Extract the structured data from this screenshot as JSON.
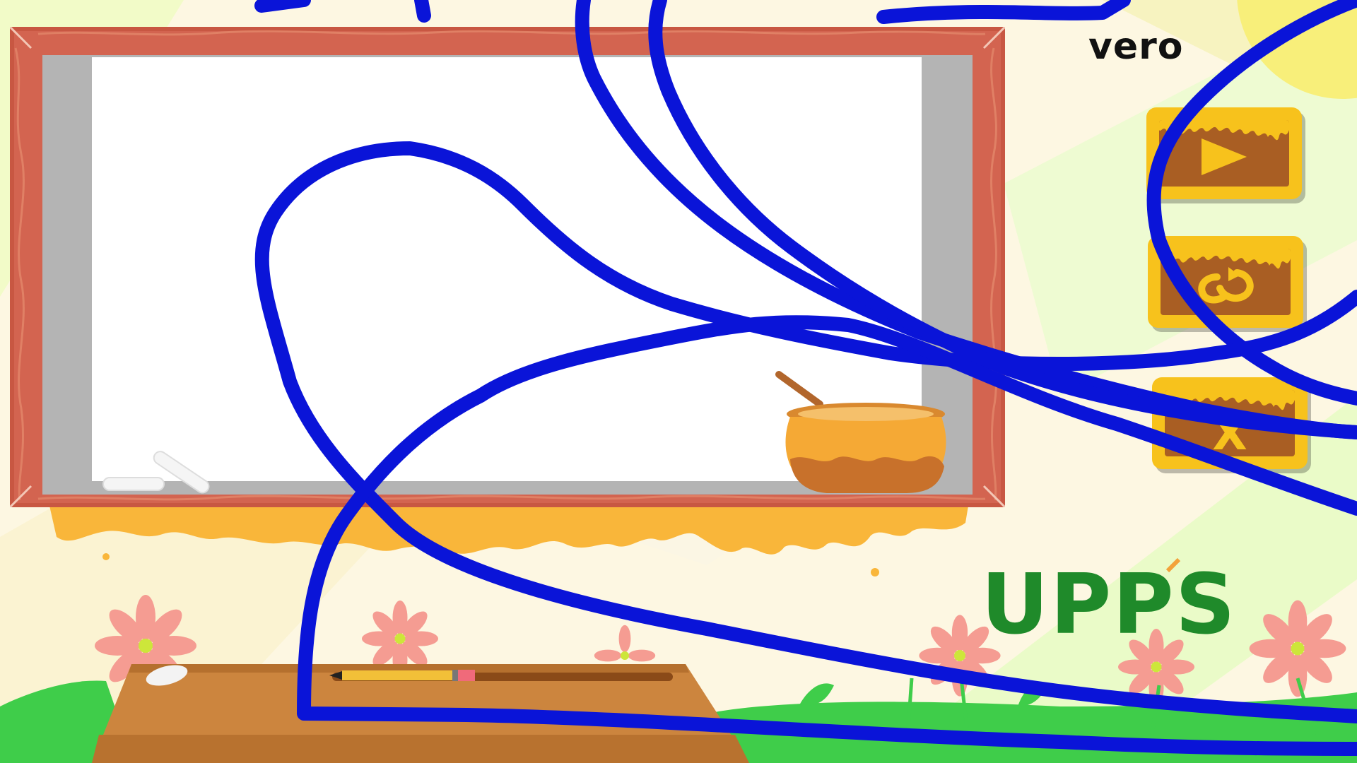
{
  "player": {
    "name": "vero"
  },
  "buttons": {
    "play": {
      "icon": "play-icon"
    },
    "restart": {
      "icon": "restart-icon"
    },
    "close": {
      "icon": "close-icon",
      "label": "X"
    }
  },
  "logo": {
    "text": "UPPS"
  },
  "colors": {
    "board_frame": "#d36450",
    "board_border": "#b4b4b4",
    "button_yellow": "#f7c21c",
    "button_brown": "#a95e23",
    "honey": "#f9b63a",
    "grass": "#3fcd4a",
    "desk": "#cc853e",
    "stroke": "#0a14d8",
    "logo": "#1f8a2a"
  }
}
